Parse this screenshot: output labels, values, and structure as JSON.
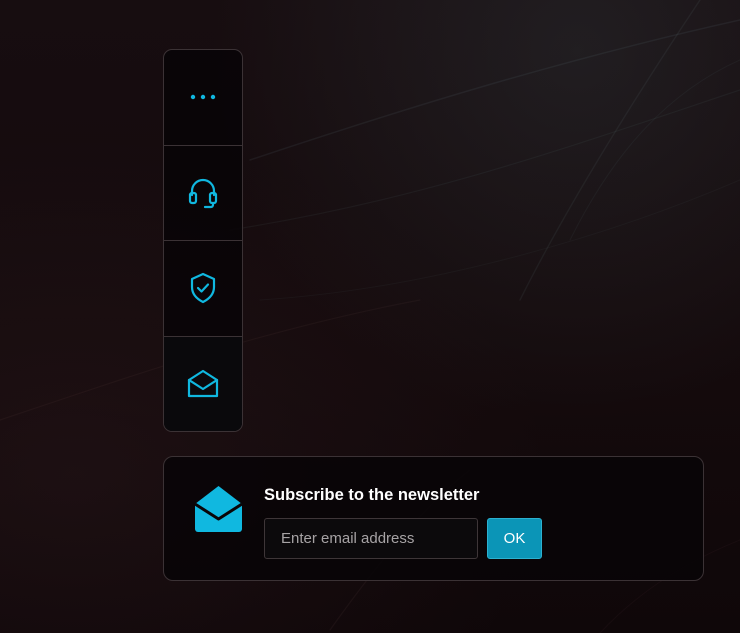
{
  "colors": {
    "accent": "#10b8e0",
    "button_bg": "#0b95b7",
    "panel_border": "#3b3235",
    "background": "#130a0c"
  },
  "toolbar": {
    "items": [
      {
        "icon": "more-dots-icon"
      },
      {
        "icon": "headset-icon"
      },
      {
        "icon": "shield-check-icon"
      },
      {
        "icon": "envelope-open-icon",
        "active": true
      }
    ]
  },
  "newsletter": {
    "icon": "envelope-open-icon",
    "title": "Subscribe to the newsletter",
    "email_placeholder": "Enter email address",
    "email_value": "",
    "submit_label": "OK"
  }
}
